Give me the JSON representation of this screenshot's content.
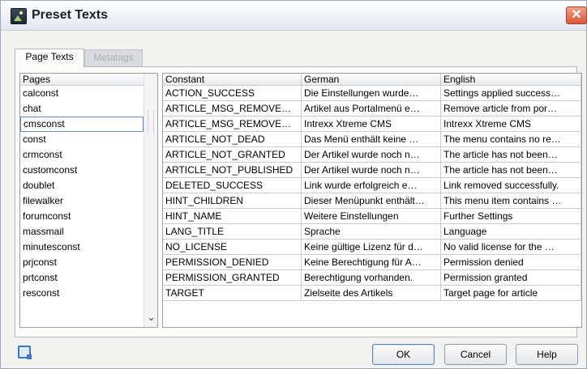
{
  "window": {
    "title": "Preset Texts",
    "close_glyph": "✕"
  },
  "tabs": [
    {
      "label": "Page Texts",
      "active": true
    },
    {
      "label": "Metatags",
      "active": false
    }
  ],
  "pages_list": {
    "header": "Pages",
    "selected": "cmsconst",
    "items": [
      "calconst",
      "chat",
      "cmsconst",
      "const",
      "crmconst",
      "customconst",
      "doublet",
      "filewalker",
      "forumconst",
      "massmail",
      "minutesconst",
      "prjconst",
      "prtconst",
      "resconst"
    ]
  },
  "text_table": {
    "columns": [
      "Constant",
      "German",
      "English"
    ],
    "rows": [
      [
        "ACTION_SUCCESS",
        "Die Einstellungen wurde…",
        "Settings applied success…"
      ],
      [
        "ARTICLE_MSG_REMOVE…",
        "Artikel aus Portalmenü e…",
        "Remove article from por…"
      ],
      [
        "ARTICLE_MSG_REMOVE…",
        "Intrexx Xtreme CMS",
        "Intrexx Xtreme CMS"
      ],
      [
        "ARTICLE_NOT_DEAD",
        "Das Menü enthält keine …",
        "The menu contains no re…"
      ],
      [
        "ARTICLE_NOT_GRANTED",
        "Der Artikel wurde noch n…",
        "The article has not been…"
      ],
      [
        "ARTICLE_NOT_PUBLISHED",
        "Der Artikel wurde noch n…",
        "The article has not been…"
      ],
      [
        "DELETED_SUCCESS",
        "Link wurde erfolgreich e…",
        "Link removed successfully."
      ],
      [
        "HINT_CHILDREN",
        "Dieser Menüpunkt enthält…",
        "This menu item contains …"
      ],
      [
        "HINT_NAME",
        "Weitere Einstellungen",
        "Further Settings"
      ],
      [
        "LANG_TITLE",
        "Sprache",
        "Language"
      ],
      [
        "NO_LICENSE",
        "Keine gültige Lizenz für d…",
        "No valid license for the …"
      ],
      [
        "PERMISSION_DENIED",
        "Keine Berechtigung für A…",
        "Permission denied"
      ],
      [
        "PERMISSION_GRANTED",
        "Berechtigung vorhanden.",
        "Permission granted"
      ],
      [
        "TARGET",
        "Zielseite des Artikels",
        "Target page for article"
      ]
    ]
  },
  "buttons": {
    "ok": "OK",
    "cancel": "Cancel",
    "help": "Help"
  },
  "colors": {
    "close_button": "#d9563c",
    "selection_border": "#6d8bb5",
    "inactive_tab_text": "#a9aeb3"
  }
}
